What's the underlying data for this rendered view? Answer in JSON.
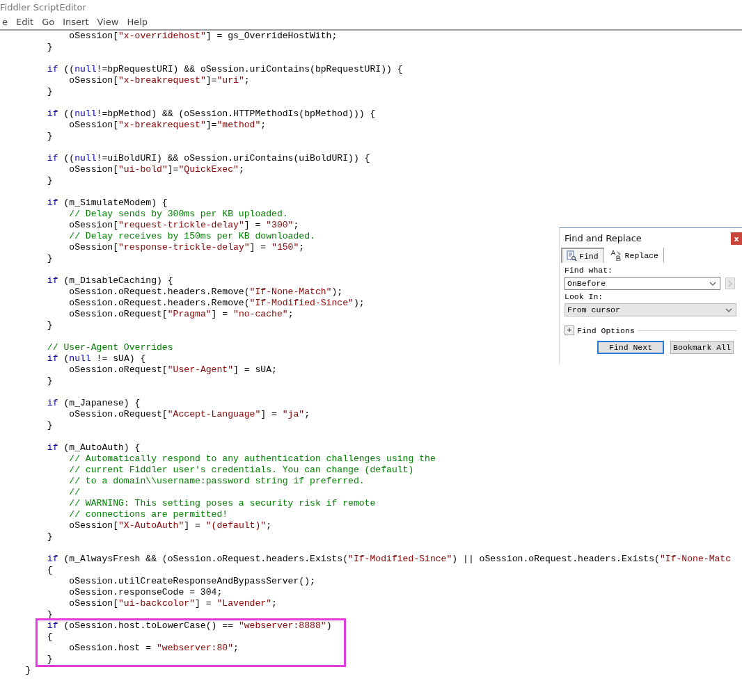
{
  "window": {
    "title": "Fiddler ScriptEditor"
  },
  "menu": [
    "e",
    "Edit",
    "Go",
    "Insert",
    "View",
    "Help"
  ],
  "code": {
    "blocks": [
      {
        "highlighted": false,
        "groups": [
          [
            [
              {
                "kind": "plain",
                "text": "            oSession["
              },
              {
                "kind": "string",
                "text": "\"x-overridehost\""
              },
              {
                "kind": "plain",
                "text": "] = gs_OverrideHostWith;"
              }
            ],
            [
              {
                "kind": "plain",
                "text": "        }"
              }
            ]
          ],
          [
            [
              {
                "kind": "keyword",
                "text": "        if"
              },
              {
                "kind": "plain",
                "text": " (("
              },
              {
                "kind": "keyword",
                "text": "null"
              },
              {
                "kind": "plain",
                "text": "!=bpRequestURI) && oSession.uriContains(bpRequestURI)) {"
              }
            ],
            [
              {
                "kind": "plain",
                "text": "            oSession["
              },
              {
                "kind": "string",
                "text": "\"x-breakrequest\""
              },
              {
                "kind": "plain",
                "text": "]="
              },
              {
                "kind": "string",
                "text": "\"uri\""
              },
              {
                "kind": "plain",
                "text": ";"
              }
            ],
            [
              {
                "kind": "plain",
                "text": "        }"
              }
            ]
          ],
          [
            [
              {
                "kind": "keyword",
                "text": "        if"
              },
              {
                "kind": "plain",
                "text": " (("
              },
              {
                "kind": "keyword",
                "text": "null"
              },
              {
                "kind": "plain",
                "text": "!=bpMethod) && (oSession.HTTPMethodIs(bpMethod))) {"
              }
            ],
            [
              {
                "kind": "plain",
                "text": "            oSession["
              },
              {
                "kind": "string",
                "text": "\"x-breakrequest\""
              },
              {
                "kind": "plain",
                "text": "]="
              },
              {
                "kind": "string",
                "text": "\"method\""
              },
              {
                "kind": "plain",
                "text": ";"
              }
            ],
            [
              {
                "kind": "plain",
                "text": "        }"
              }
            ]
          ],
          [
            [
              {
                "kind": "keyword",
                "text": "        if"
              },
              {
                "kind": "plain",
                "text": " (("
              },
              {
                "kind": "keyword",
                "text": "null"
              },
              {
                "kind": "plain",
                "text": "!=uiBoldURI) && oSession.uriContains(uiBoldURI)) {"
              }
            ],
            [
              {
                "kind": "plain",
                "text": "            oSession["
              },
              {
                "kind": "string",
                "text": "\"ui-bold\""
              },
              {
                "kind": "plain",
                "text": "]="
              },
              {
                "kind": "string",
                "text": "\"QuickExec\""
              },
              {
                "kind": "plain",
                "text": ";"
              }
            ],
            [
              {
                "kind": "plain",
                "text": "        }"
              }
            ]
          ],
          [
            [
              {
                "kind": "keyword",
                "text": "        if"
              },
              {
                "kind": "plain",
                "text": " (m_SimulateModem) {"
              }
            ],
            [
              {
                "kind": "comment",
                "text": "            // Delay sends by 300ms per KB uploaded."
              }
            ],
            [
              {
                "kind": "plain",
                "text": "            oSession["
              },
              {
                "kind": "string",
                "text": "\"request-trickle-delay\""
              },
              {
                "kind": "plain",
                "text": "] = "
              },
              {
                "kind": "string",
                "text": "\"300\""
              },
              {
                "kind": "plain",
                "text": ";"
              }
            ],
            [
              {
                "kind": "comment",
                "text": "            // Delay receives by 150ms per KB downloaded."
              }
            ],
            [
              {
                "kind": "plain",
                "text": "            oSession["
              },
              {
                "kind": "string",
                "text": "\"response-trickle-delay\""
              },
              {
                "kind": "plain",
                "text": "] = "
              },
              {
                "kind": "string",
                "text": "\"150\""
              },
              {
                "kind": "plain",
                "text": ";"
              }
            ],
            [
              {
                "kind": "plain",
                "text": "        }"
              }
            ]
          ],
          [
            [
              {
                "kind": "keyword",
                "text": "        if"
              },
              {
                "kind": "plain",
                "text": " (m_DisableCaching) {"
              }
            ],
            [
              {
                "kind": "plain",
                "text": "            oSession.oRequest.headers.Remove("
              },
              {
                "kind": "string",
                "text": "\"If-None-Match\""
              },
              {
                "kind": "plain",
                "text": ");"
              }
            ],
            [
              {
                "kind": "plain",
                "text": "            oSession.oRequest.headers.Remove("
              },
              {
                "kind": "string",
                "text": "\"If-Modified-Since\""
              },
              {
                "kind": "plain",
                "text": ");"
              }
            ],
            [
              {
                "kind": "plain",
                "text": "            oSession.oRequest["
              },
              {
                "kind": "string",
                "text": "\"Pragma\""
              },
              {
                "kind": "plain",
                "text": "] = "
              },
              {
                "kind": "string",
                "text": "\"no-cache\""
              },
              {
                "kind": "plain",
                "text": ";"
              }
            ],
            [
              {
                "kind": "plain",
                "text": "        }"
              }
            ]
          ],
          [
            [
              {
                "kind": "comment",
                "text": "        // User-Agent Overrides"
              }
            ],
            [
              {
                "kind": "keyword",
                "text": "        if"
              },
              {
                "kind": "plain",
                "text": " ("
              },
              {
                "kind": "keyword",
                "text": "null"
              },
              {
                "kind": "plain",
                "text": " != sUA) {"
              }
            ],
            [
              {
                "kind": "plain",
                "text": "            oSession.oRequest["
              },
              {
                "kind": "string",
                "text": "\"User-Agent\""
              },
              {
                "kind": "plain",
                "text": "] = sUA;"
              }
            ],
            [
              {
                "kind": "plain",
                "text": "        }"
              }
            ]
          ],
          [
            [
              {
                "kind": "keyword",
                "text": "        if"
              },
              {
                "kind": "plain",
                "text": " (m_Japanese) {"
              }
            ],
            [
              {
                "kind": "plain",
                "text": "            oSession.oRequest["
              },
              {
                "kind": "string",
                "text": "\"Accept-Language\""
              },
              {
                "kind": "plain",
                "text": "] = "
              },
              {
                "kind": "string",
                "text": "\"ja\""
              },
              {
                "kind": "plain",
                "text": ";"
              }
            ],
            [
              {
                "kind": "plain",
                "text": "        }"
              }
            ]
          ],
          [
            [
              {
                "kind": "keyword",
                "text": "        if"
              },
              {
                "kind": "plain",
                "text": " (m_AutoAuth) {"
              }
            ],
            [
              {
                "kind": "comment",
                "text": "            // Automatically respond to any authentication challenges using the"
              }
            ],
            [
              {
                "kind": "comment",
                "text": "            // current Fiddler user's credentials. You can change (default)"
              }
            ],
            [
              {
                "kind": "comment",
                "text": "            // to a domain\\\\username:password string if preferred."
              }
            ],
            [
              {
                "kind": "comment",
                "text": "            //"
              }
            ],
            [
              {
                "kind": "comment",
                "text": "            // WARNING: This setting poses a security risk if remote"
              }
            ],
            [
              {
                "kind": "comment",
                "text": "            // connections are permitted!"
              }
            ],
            [
              {
                "kind": "plain",
                "text": "            oSession["
              },
              {
                "kind": "string",
                "text": "\"X-AutoAuth\""
              },
              {
                "kind": "plain",
                "text": "] = "
              },
              {
                "kind": "string",
                "text": "\"(default)\""
              },
              {
                "kind": "plain",
                "text": ";"
              }
            ],
            [
              {
                "kind": "plain",
                "text": "        }"
              }
            ]
          ],
          [
            [
              {
                "kind": "keyword",
                "text": "        if"
              },
              {
                "kind": "plain",
                "text": " (m_AlwaysFresh && (oSession.oRequest.headers.Exists("
              },
              {
                "kind": "string",
                "text": "\"If-Modified-Since\""
              },
              {
                "kind": "plain",
                "text": ") || oSession.oRequest.headers.Exists("
              },
              {
                "kind": "string",
                "text": "\"If-None-Matc"
              }
            ],
            [
              {
                "kind": "plain",
                "text": "        {"
              }
            ],
            [
              {
                "kind": "plain",
                "text": "            oSession.utilCreateResponseAndBypassServer();"
              }
            ],
            [
              {
                "kind": "plain",
                "text": "            oSession.responseCode = 304;"
              }
            ],
            [
              {
                "kind": "plain",
                "text": "            oSession["
              },
              {
                "kind": "string",
                "text": "\"ui-backcolor\""
              },
              {
                "kind": "plain",
                "text": "] = "
              },
              {
                "kind": "string",
                "text": "\"Lavender\""
              },
              {
                "kind": "plain",
                "text": ";"
              }
            ],
            [
              {
                "kind": "plain",
                "text": "        }"
              }
            ]
          ]
        ]
      },
      {
        "highlighted": true,
        "groups": [
          [
            [
              {
                "kind": "keyword",
                "text": "        if"
              },
              {
                "kind": "plain",
                "text": " (oSession.host.toLowerCase() == "
              },
              {
                "kind": "string",
                "text": "\"webserver:8888\""
              },
              {
                "kind": "plain",
                "text": ")"
              }
            ],
            [
              {
                "kind": "plain",
                "text": "        {"
              }
            ],
            [
              {
                "kind": "plain",
                "text": "            oSession.host = "
              },
              {
                "kind": "string",
                "text": "\"webserver:80\""
              },
              {
                "kind": "plain",
                "text": ";"
              }
            ],
            [
              {
                "kind": "plain",
                "text": "        }"
              }
            ]
          ]
        ]
      },
      {
        "highlighted": false,
        "groups": [
          [
            [
              {
                "kind": "plain",
                "text": "    }"
              }
            ]
          ]
        ]
      }
    ]
  },
  "find_dialog": {
    "title": "Find and Replace",
    "close": "x",
    "tabs": [
      {
        "label": "Find",
        "kind": "find",
        "selected": true
      },
      {
        "label": "Replace",
        "kind": "replace",
        "selected": false
      }
    ],
    "find_what_label": "Find what:",
    "find_what_value": "OnBefore",
    "next_button_disabled": true,
    "look_in_label": "Look In:",
    "look_in_value": "From cursor",
    "options_toggle": "+",
    "options_label": "Find Options",
    "options_expanded": false,
    "buttons": [
      {
        "label": "Find Next",
        "default": true
      },
      {
        "label": "Bookmark All",
        "default": false
      }
    ]
  }
}
